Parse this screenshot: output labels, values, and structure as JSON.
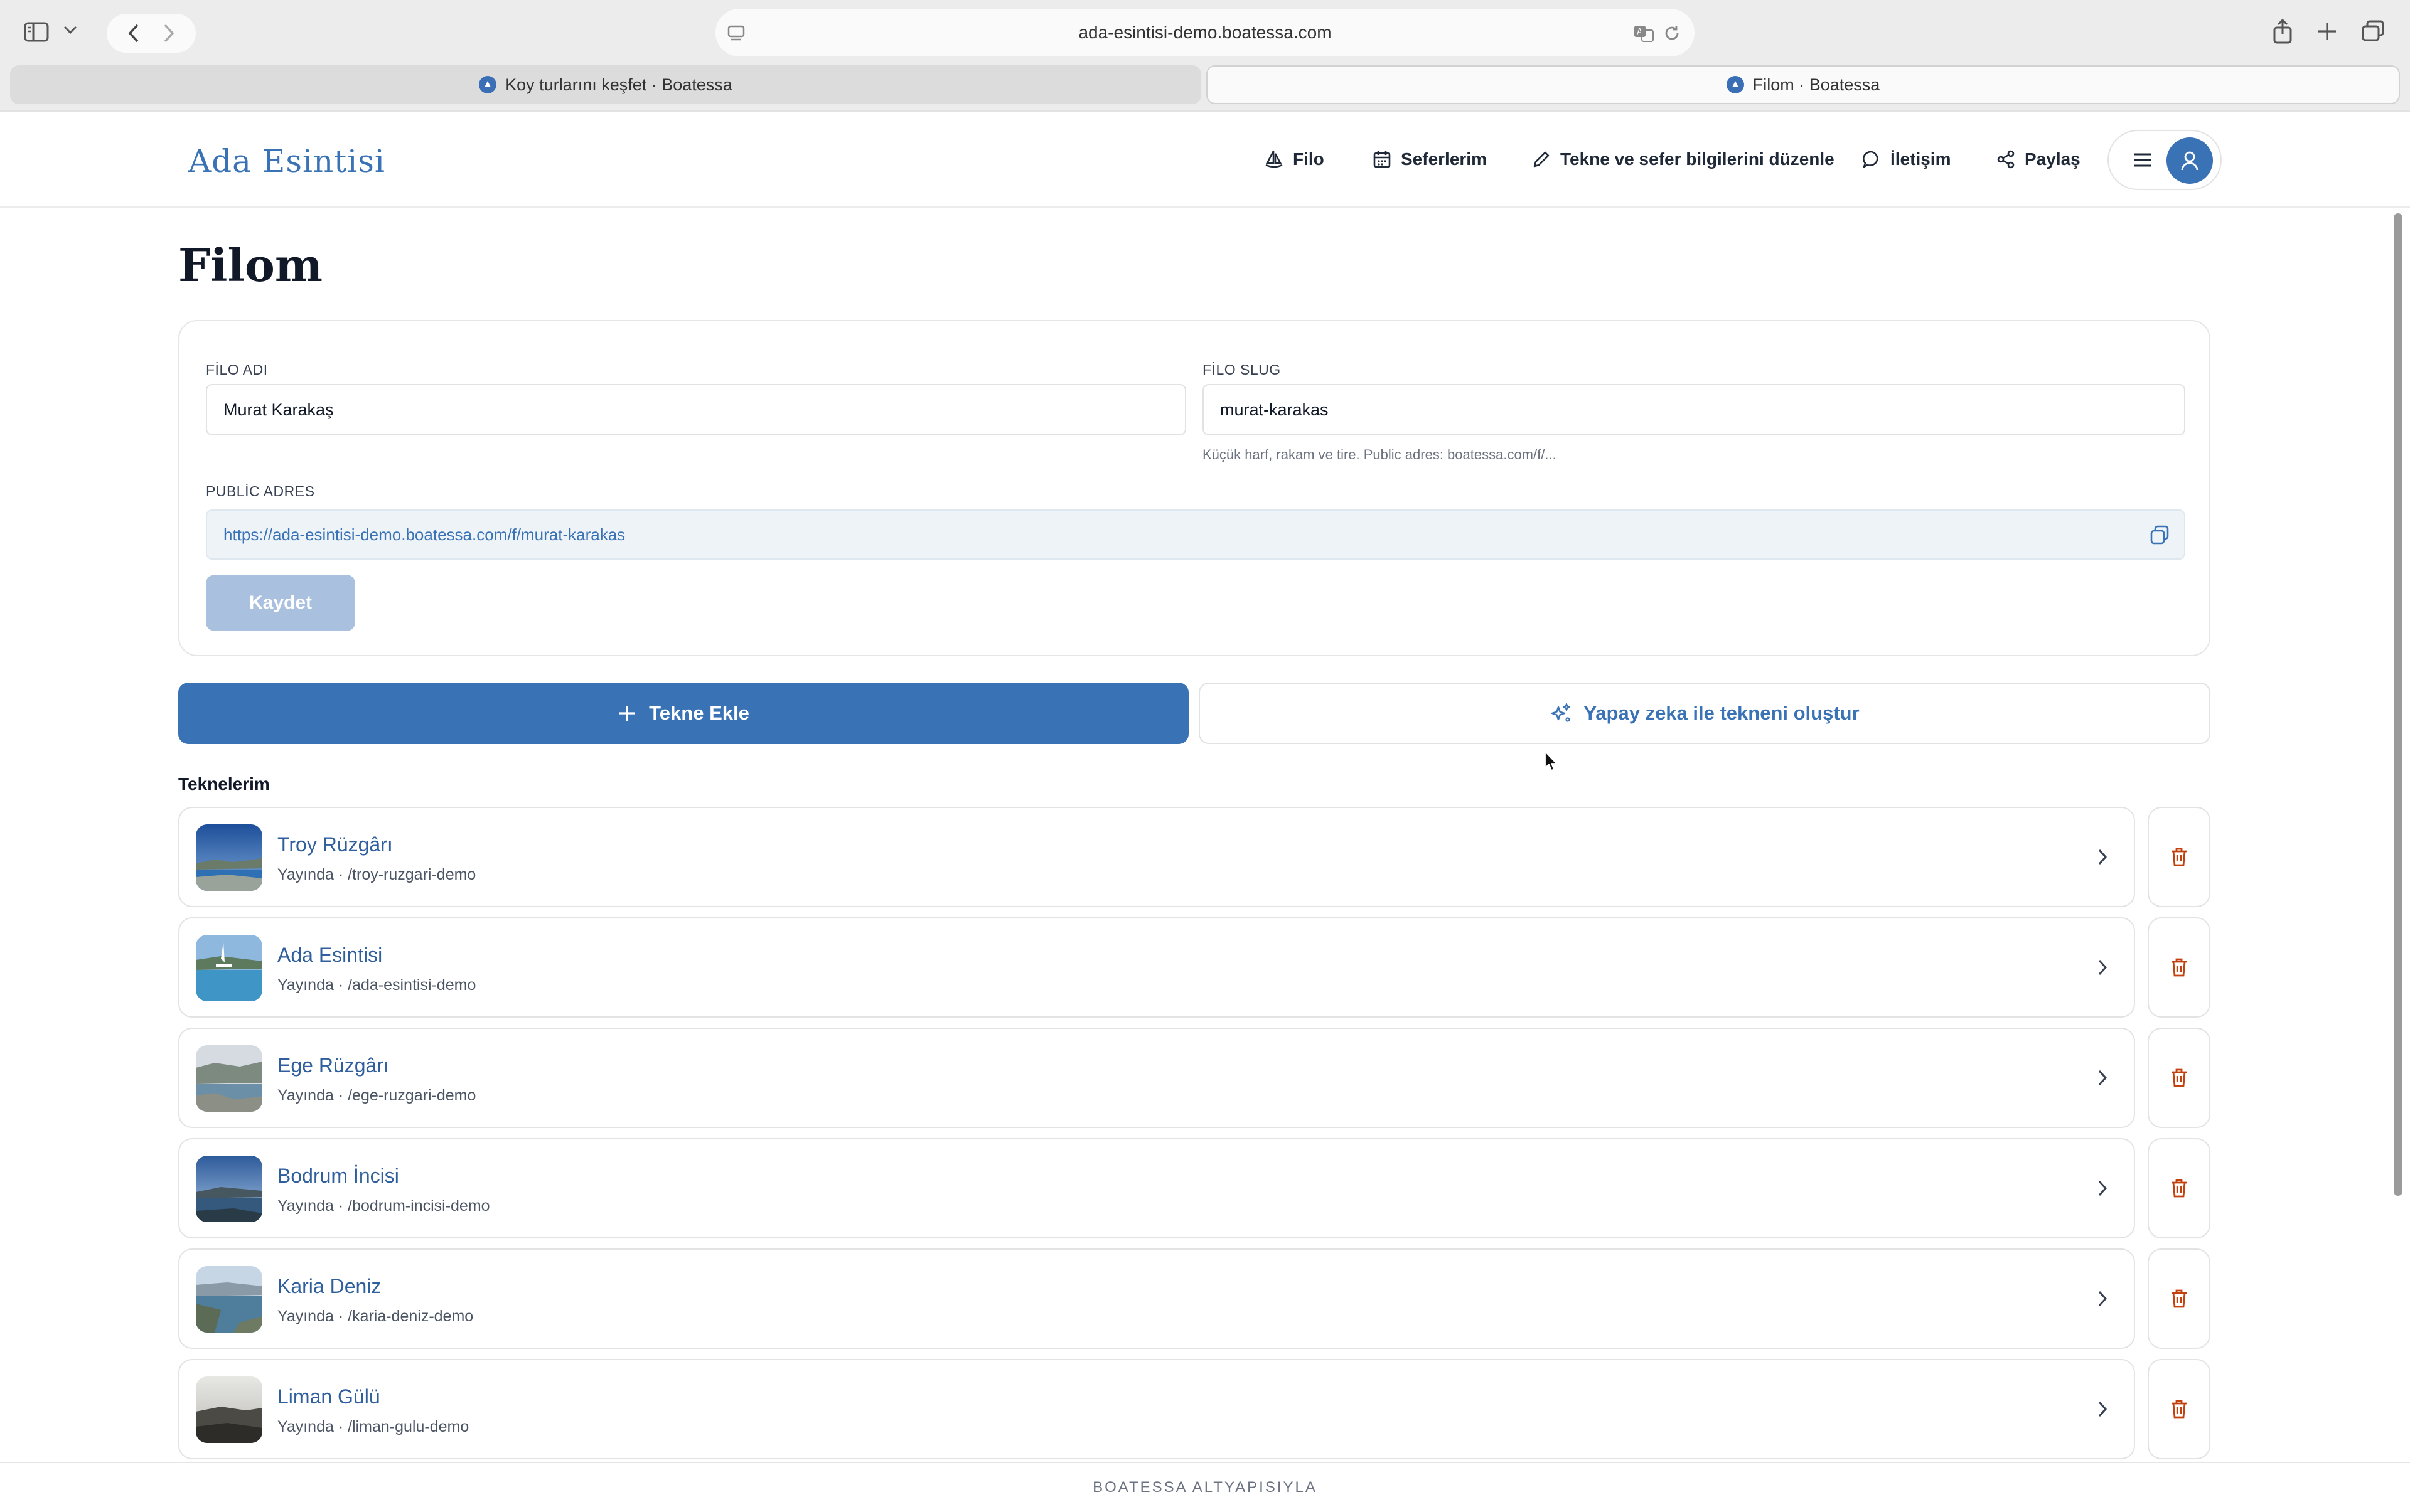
{
  "browser": {
    "url": "ada-esintisi-demo.boatessa.com",
    "tabs": [
      {
        "title": "Koy turlarını keşfet · Boatessa",
        "active": false
      },
      {
        "title": "Filom · Boatessa",
        "active": true
      }
    ]
  },
  "header": {
    "brand": "Ada Esintisi",
    "nav": {
      "filo": "Filo",
      "seferlerim": "Seferlerim",
      "duzenle": "Tekne ve sefer bilgilerini düzenle",
      "iletisim": "İletişim",
      "paylas": "Paylaş"
    }
  },
  "page": {
    "title": "Filom"
  },
  "fleet_form": {
    "name_label": "FİLO ADI",
    "name_value": "Murat Karakaş",
    "slug_label": "FİLO SLUG",
    "slug_value": "murat-karakas",
    "slug_hint": "Küçük harf, rakam ve tire. Public adres: boatessa.com/f/...",
    "public_label": "PUBLİC ADRES",
    "public_url": "https://ada-esintisi-demo.boatessa.com/f/murat-karakas",
    "save_label": "Kaydet"
  },
  "actions": {
    "add_boat": "Tekne Ekle",
    "ai_create": "Yapay zeka ile tekneni oluştur"
  },
  "boats": {
    "section_title": "Teknelerim",
    "items": [
      {
        "name": "Troy Rüzgârı",
        "status": "Yayında · /troy-ruzgari-demo"
      },
      {
        "name": "Ada Esintisi",
        "status": "Yayında · /ada-esintisi-demo"
      },
      {
        "name": "Ege Rüzgârı",
        "status": "Yayında · /ege-ruzgari-demo"
      },
      {
        "name": "Bodrum İncisi",
        "status": "Yayında · /bodrum-incisi-demo"
      },
      {
        "name": "Karia Deniz",
        "status": "Yayında · /karia-deniz-demo"
      },
      {
        "name": "Liman Gülü",
        "status": "Yayında · /liman-gulu-demo"
      }
    ]
  },
  "footer": {
    "text": "BOATESSA ALTYAPISIYLA"
  },
  "colors": {
    "brand": "#3a72b6",
    "delete": "#c2410c",
    "save_disabled": "#a9c1df"
  }
}
